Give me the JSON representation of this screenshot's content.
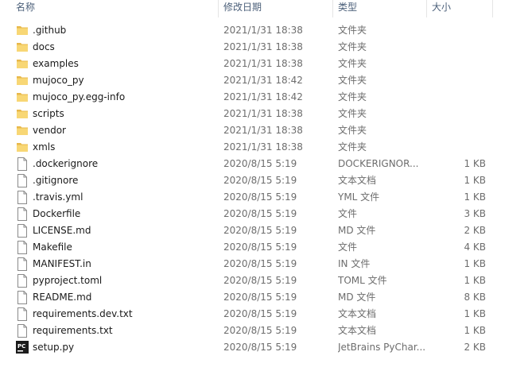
{
  "columns": {
    "name": "名称",
    "modified": "修改日期",
    "type": "类型",
    "size": "大小"
  },
  "files": [
    {
      "name": ".github",
      "modified": "2021/1/31 18:38",
      "type": "文件夹",
      "size": "",
      "icon": "folder-icon"
    },
    {
      "name": "docs",
      "modified": "2021/1/31 18:38",
      "type": "文件夹",
      "size": "",
      "icon": "folder-icon"
    },
    {
      "name": "examples",
      "modified": "2021/1/31 18:38",
      "type": "文件夹",
      "size": "",
      "icon": "folder-icon"
    },
    {
      "name": "mujoco_py",
      "modified": "2021/1/31 18:42",
      "type": "文件夹",
      "size": "",
      "icon": "folder-icon"
    },
    {
      "name": "mujoco_py.egg-info",
      "modified": "2021/1/31 18:42",
      "type": "文件夹",
      "size": "",
      "icon": "folder-icon"
    },
    {
      "name": "scripts",
      "modified": "2021/1/31 18:38",
      "type": "文件夹",
      "size": "",
      "icon": "folder-icon"
    },
    {
      "name": "vendor",
      "modified": "2021/1/31 18:38",
      "type": "文件夹",
      "size": "",
      "icon": "folder-icon"
    },
    {
      "name": "xmls",
      "modified": "2021/1/31 18:38",
      "type": "文件夹",
      "size": "",
      "icon": "folder-icon"
    },
    {
      "name": ".dockerignore",
      "modified": "2020/8/15 5:19",
      "type": "DOCKERIGNOR...",
      "size": "1 KB",
      "icon": "file-icon"
    },
    {
      "name": ".gitignore",
      "modified": "2020/8/15 5:19",
      "type": "文本文档",
      "size": "1 KB",
      "icon": "file-icon"
    },
    {
      "name": ".travis.yml",
      "modified": "2020/8/15 5:19",
      "type": "YML 文件",
      "size": "1 KB",
      "icon": "file-icon"
    },
    {
      "name": "Dockerfile",
      "modified": "2020/8/15 5:19",
      "type": "文件",
      "size": "3 KB",
      "icon": "file-icon"
    },
    {
      "name": "LICENSE.md",
      "modified": "2020/8/15 5:19",
      "type": "MD 文件",
      "size": "2 KB",
      "icon": "file-icon"
    },
    {
      "name": "Makefile",
      "modified": "2020/8/15 5:19",
      "type": "文件",
      "size": "4 KB",
      "icon": "file-icon"
    },
    {
      "name": "MANIFEST.in",
      "modified": "2020/8/15 5:19",
      "type": "IN 文件",
      "size": "1 KB",
      "icon": "file-icon"
    },
    {
      "name": "pyproject.toml",
      "modified": "2020/8/15 5:19",
      "type": "TOML 文件",
      "size": "1 KB",
      "icon": "file-icon"
    },
    {
      "name": "README.md",
      "modified": "2020/8/15 5:19",
      "type": "MD 文件",
      "size": "8 KB",
      "icon": "file-icon"
    },
    {
      "name": "requirements.dev.txt",
      "modified": "2020/8/15 5:19",
      "type": "文本文档",
      "size": "1 KB",
      "icon": "file-icon"
    },
    {
      "name": "requirements.txt",
      "modified": "2020/8/15 5:19",
      "type": "文本文档",
      "size": "1 KB",
      "icon": "file-icon"
    },
    {
      "name": "setup.py",
      "modified": "2020/8/15 5:19",
      "type": "JetBrains PyChar...",
      "size": "2 KB",
      "icon": "pycharm-icon"
    }
  ],
  "colors": {
    "folder": "#f8d775",
    "folder_dark": "#e8b84a",
    "header_text": "#4c607a",
    "secondary_text": "#6d6d6d"
  }
}
